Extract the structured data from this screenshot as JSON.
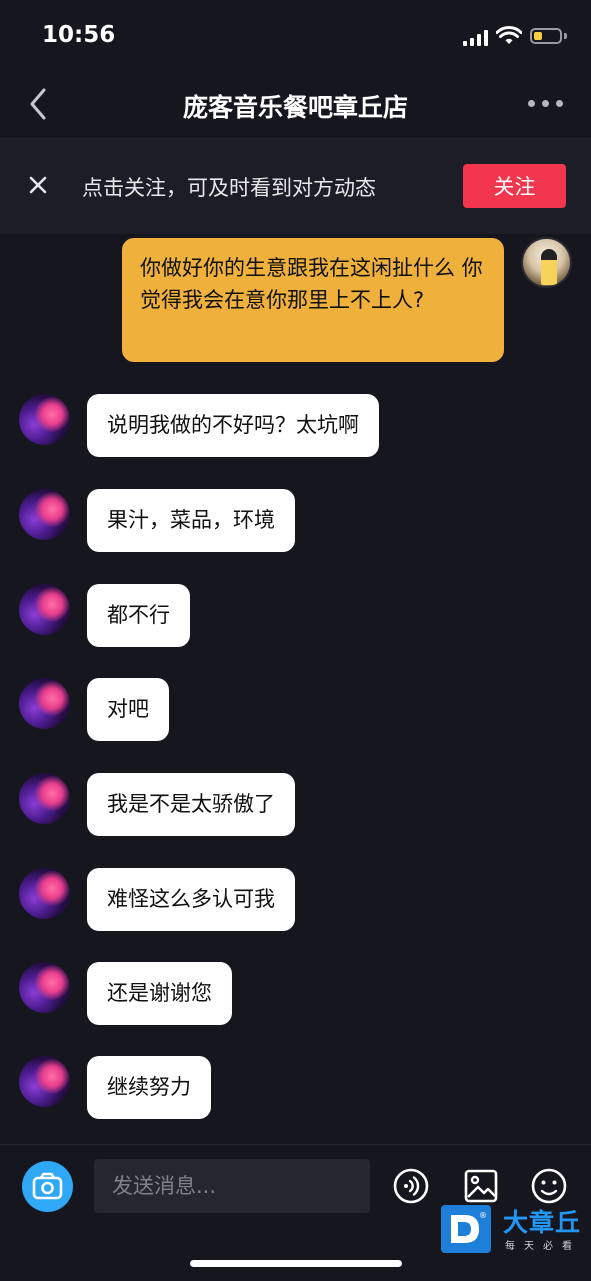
{
  "status_bar": {
    "time": "10:56"
  },
  "header": {
    "title": "庞客音乐餐吧章丘店"
  },
  "follow_banner": {
    "text": "点击关注，可及时看到对方动态",
    "button_label": "关注"
  },
  "messages": [
    {
      "direction": "outgoing",
      "text": "你做好你的生意跟我在这闲扯什么 你觉得我会在意你那里上不上人?"
    },
    {
      "direction": "incoming",
      "text": "说明我做的不好吗？太坑啊"
    },
    {
      "direction": "incoming",
      "text": "果汁，菜品，环境"
    },
    {
      "direction": "incoming",
      "text": "都不行"
    },
    {
      "direction": "incoming",
      "text": "对吧"
    },
    {
      "direction": "incoming",
      "text": "我是不是太骄傲了"
    },
    {
      "direction": "incoming",
      "text": "难怪这么多认可我"
    },
    {
      "direction": "incoming",
      "text": "还是谢谢您"
    },
    {
      "direction": "incoming",
      "text": "继续努力"
    }
  ],
  "input_bar": {
    "placeholder": "发送消息..."
  },
  "watermark": {
    "title": "大章丘",
    "slogan": "每天必看"
  },
  "colors": {
    "background": "#16161f",
    "banner": "#1d1d27",
    "follow_button": "#f2364e",
    "outgoing_bubble": "#f0b13c",
    "incoming_bubble": "#ffffff",
    "camera_button": "#2fa8f5"
  },
  "icons": {
    "back": "chevron-left-icon",
    "more": "more-dots-icon",
    "close": "close-icon",
    "camera": "camera-icon",
    "voice": "voice-icon",
    "image": "image-icon",
    "emoji": "emoji-icon"
  }
}
